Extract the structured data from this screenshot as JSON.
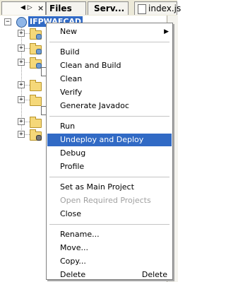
{
  "tabs": {
    "projects_controls": "◀ ▷",
    "files": "Files",
    "services": "Serv...",
    "editor": "index.js"
  },
  "tree": {
    "selected_project": "IFPWAECAD"
  },
  "menu": {
    "groups": [
      [
        {
          "label": "New",
          "submenu": true
        }
      ],
      [
        {
          "label": "Build"
        },
        {
          "label": "Clean and Build"
        },
        {
          "label": "Clean"
        },
        {
          "label": "Verify"
        },
        {
          "label": "Generate Javadoc"
        }
      ],
      [
        {
          "label": "Run"
        },
        {
          "label": "Undeploy and Deploy",
          "highlighted": true
        },
        {
          "label": "Debug"
        },
        {
          "label": "Profile"
        }
      ],
      [
        {
          "label": "Set as Main Project"
        },
        {
          "label": "Open Required Projects",
          "disabled": true
        },
        {
          "label": "Close"
        }
      ],
      [
        {
          "label": "Rename..."
        },
        {
          "label": "Move..."
        },
        {
          "label": "Copy..."
        },
        {
          "label": "Delete",
          "accelerator": "Delete"
        }
      ]
    ]
  },
  "colors": {
    "selection": "#316ac5",
    "menu_border": "#7f7f7f",
    "disabled_text": "#a0a0a0"
  }
}
